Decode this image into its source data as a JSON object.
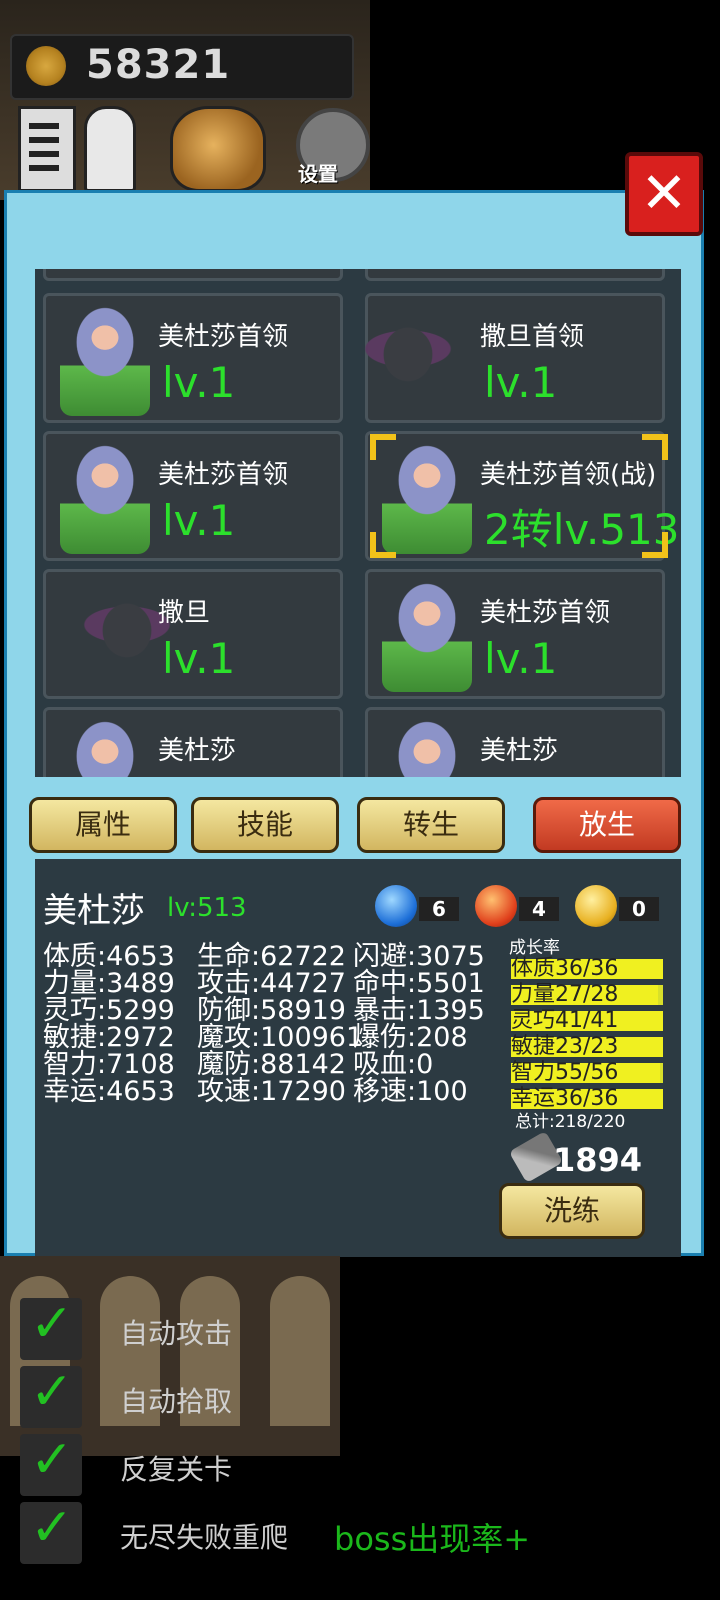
{
  "header": {
    "coins": "58321",
    "settings_label": "设置"
  },
  "close_label": "✕",
  "pets": [
    {
      "name": "美杜莎首领",
      "level": "lv.1",
      "type": "medusa"
    },
    {
      "name": "撒旦首领",
      "level": "lv.1",
      "type": "satan"
    },
    {
      "name": "美杜莎首领",
      "level": "lv.1",
      "type": "medusa"
    },
    {
      "name": "美杜莎首领(战)",
      "level": "2转lv.513",
      "type": "medusa",
      "selected": true
    },
    {
      "name": "撒旦",
      "level": "lv.1",
      "type": "satan"
    },
    {
      "name": "美杜莎首领",
      "level": "lv.1",
      "type": "medusa"
    },
    {
      "name": "美杜莎",
      "level": "",
      "type": "medusa"
    },
    {
      "name": "美杜莎",
      "level": "",
      "type": "medusa"
    }
  ],
  "tabs": {
    "attributes": "属性",
    "skills": "技能",
    "rebirth": "转生",
    "release": "放生"
  },
  "detail": {
    "name": "美杜莎",
    "level": "lv:513",
    "orbs": {
      "water": "6",
      "fire": "4",
      "lightning": "0"
    },
    "stats_col1": [
      "体质:4653",
      "力量:3489",
      "灵巧:5299",
      "敏捷:2972",
      "智力:7108",
      "幸运:4653"
    ],
    "stats_col2": [
      "生命:62722",
      "攻击:44727",
      "防御:58919",
      "魔攻:100961",
      "魔防:88142",
      "攻速:17290"
    ],
    "stats_col3": [
      "闪避:3075",
      "命中:5501",
      "暴击:1395",
      "爆伤:208",
      "吸血:0",
      "移速:100"
    ],
    "growth_title": "成长率",
    "growth": [
      {
        "label": "体质36/36",
        "cur": 36,
        "max": 36
      },
      {
        "label": "力量27/28",
        "cur": 27,
        "max": 28
      },
      {
        "label": "灵巧41/41",
        "cur": 41,
        "max": 41
      },
      {
        "label": "敏捷23/23",
        "cur": 23,
        "max": 23
      },
      {
        "label": "智力55/56",
        "cur": 55,
        "max": 56
      },
      {
        "label": "幸运36/36",
        "cur": 36,
        "max": 36
      }
    ],
    "growth_total": "总计:218/220",
    "scroll_count": "1894",
    "wash_label": "洗练"
  },
  "settings": [
    {
      "label": "自动攻击",
      "checked": true
    },
    {
      "label": "自动拾取",
      "checked": true
    },
    {
      "label": "反复关卡",
      "checked": true
    },
    {
      "label": "无尽失败重爬",
      "checked": true
    }
  ],
  "boss_rate_label": "boss出现率+",
  "colors": {
    "level_green": "#2ce02c",
    "panel_bg": "#8fd6ea",
    "release_red": "#d9432a"
  }
}
